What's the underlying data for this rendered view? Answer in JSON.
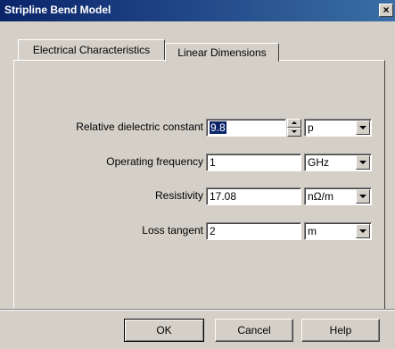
{
  "window": {
    "title": "Stripline Bend Model",
    "close": "×"
  },
  "tabs": [
    {
      "label": "Electrical Characteristics",
      "active": true
    },
    {
      "label": "Linear Dimensions",
      "active": false
    }
  ],
  "fields": [
    {
      "label": "Relative dielectric constant",
      "value": "9.8",
      "unit": "p"
    },
    {
      "label": "Operating frequency",
      "value": "1",
      "unit": "GHz"
    },
    {
      "label": "Resistivity",
      "value": "17.08",
      "unit": "nΩ/m"
    },
    {
      "label": "Loss tangent",
      "value": "2",
      "unit": "m"
    }
  ],
  "buttons": {
    "ok": "OK",
    "cancel": "Cancel",
    "help": "Help"
  }
}
